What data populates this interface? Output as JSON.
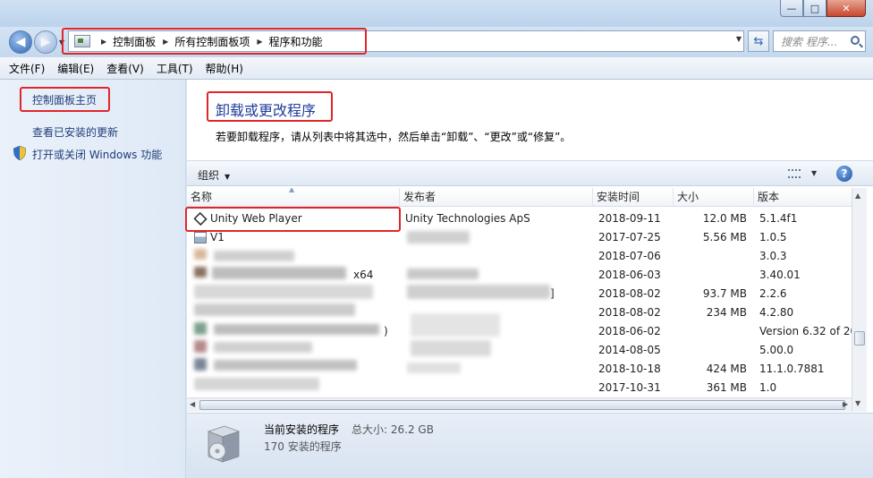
{
  "window": {
    "controls": {
      "minimize": "—",
      "maximize": "□",
      "close": "✕"
    }
  },
  "nav": {
    "back_icon": "back-arrow-icon",
    "forward_icon": "forward-arrow-icon",
    "breadcrumbs": [
      "控制面板",
      "所有控制面板项",
      "程序和功能"
    ],
    "search_placeholder": "搜索 程序..."
  },
  "menu": [
    "文件(F)",
    "编辑(E)",
    "查看(V)",
    "工具(T)",
    "帮助(H)"
  ],
  "sidebar": {
    "home": "控制面板主页",
    "links": [
      "查看已安装的更新",
      "打开或关闭 Windows 功能"
    ]
  },
  "main": {
    "title": "卸载或更改程序",
    "description": "若要卸载程序，请从列表中将其选中，然后单击“卸载”、“更改”或“修复”。"
  },
  "toolbar": {
    "organize": "组织",
    "help": "?"
  },
  "table": {
    "columns": [
      "名称",
      "发布者",
      "安装时间",
      "大小",
      "版本"
    ],
    "rows": [
      {
        "name": "Unity Web Player",
        "publisher": "Unity Technologies ApS",
        "date": "2018-09-11",
        "size": "12.0 MB",
        "version": "5.1.4f1"
      },
      {
        "name": "V1",
        "publisher": "",
        "date": "2017-07-25",
        "size": "5.56 MB",
        "version": "1.0.5"
      },
      {
        "name": "",
        "publisher": "",
        "date": "2018-07-06",
        "size": "",
        "version": "3.0.3"
      },
      {
        "name": "x64",
        "publisher": "",
        "date": "2018-06-03",
        "size": "",
        "version": "3.40.01"
      },
      {
        "name": "",
        "publisher": "]",
        "date": "2018-08-02",
        "size": "93.7 MB",
        "version": "2.2.6"
      },
      {
        "name": "",
        "publisher": "",
        "date": "2018-08-02",
        "size": "234 MB",
        "version": "4.2.80"
      },
      {
        "name": ")",
        "publisher": "",
        "date": "2018-06-02",
        "size": "",
        "version": "Version 6.32 of 20"
      },
      {
        "name": "",
        "publisher": "",
        "date": "2014-08-05",
        "size": "",
        "version": "5.00.0"
      },
      {
        "name": "",
        "publisher": "",
        "date": "2018-10-18",
        "size": "424 MB",
        "version": "11.1.0.7881"
      },
      {
        "name": "",
        "publisher": "",
        "date": "2017-10-31",
        "size": "361 MB",
        "version": "1.0"
      }
    ]
  },
  "details": {
    "title": "当前安装的程序",
    "total_size": "总大小: 26.2 GB",
    "count": "170 安装的程序"
  },
  "colors": {
    "annotation": "#e0262a",
    "link": "#1f3d7a",
    "title": "#1f3d9a"
  }
}
